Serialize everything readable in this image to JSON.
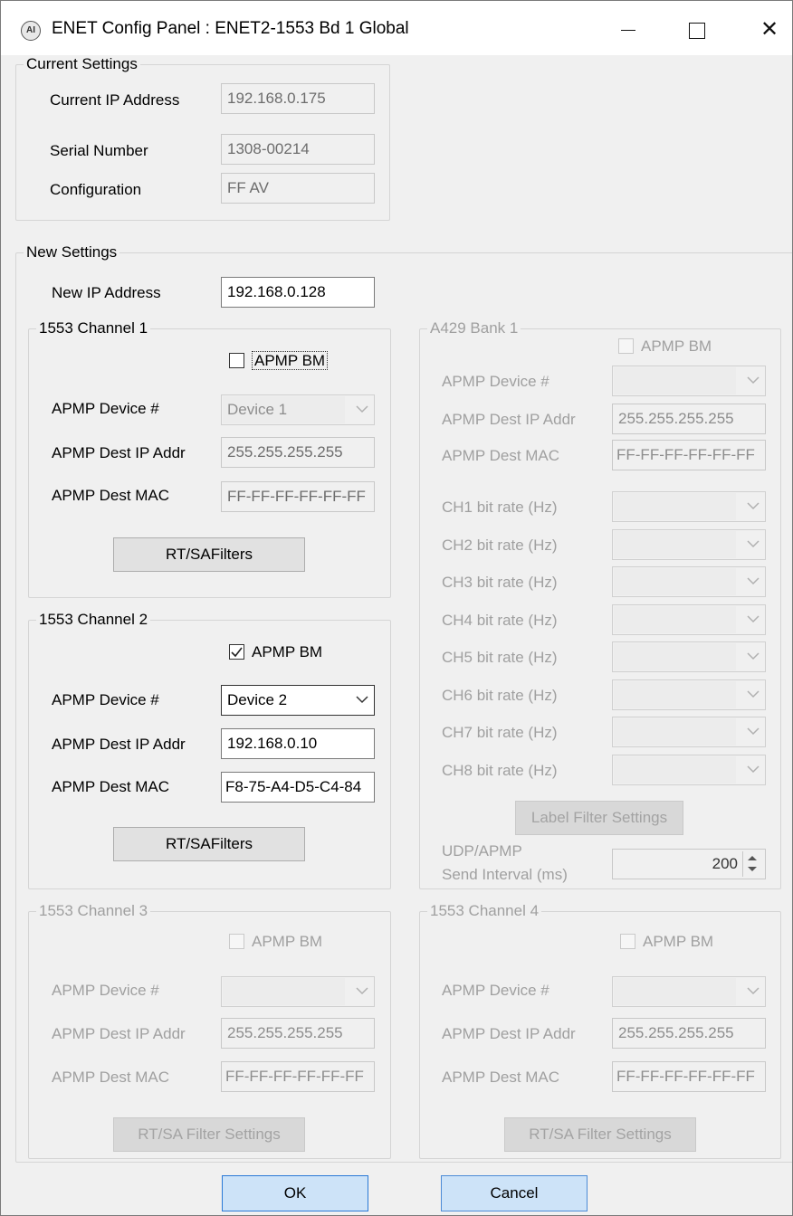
{
  "window": {
    "icon_text": "AI",
    "title": "ENET Config Panel : ENET2-1553 Bd 1 Global",
    "minimize_glyph": "",
    "close_glyph": "✕"
  },
  "current_settings": {
    "legend": "Current Settings",
    "ip_label": "Current IP Address",
    "ip_value": "192.168.0.175",
    "serial_label": "Serial Number",
    "serial_value": "1308-00214",
    "config_label": "Configuration",
    "config_value": "FF AV"
  },
  "new_settings": {
    "legend": "New Settings",
    "ip_label": "New IP Address",
    "ip_value": "192.168.0.128"
  },
  "labels": {
    "apmp_bm": "APMP BM",
    "device": "APMP Device #",
    "dest_ip": "APMP Dest IP Addr",
    "dest_mac": "APMP Dest MAC"
  },
  "channel1": {
    "legend": "1553 Channel 1",
    "apmp_bm_checked": false,
    "device": "Device 1",
    "dest_ip": "255.255.255.255",
    "dest_mac": "FF-FF-FF-FF-FF-FF",
    "filter_button": "RT/SAFilters"
  },
  "channel2": {
    "legend": "1553 Channel 2",
    "apmp_bm_checked": true,
    "device": "Device 2",
    "dest_ip": "192.168.0.10",
    "dest_mac": "F8-75-A4-D5-C4-84",
    "filter_button": "RT/SAFilters"
  },
  "channel3": {
    "legend": "1553 Channel 3",
    "apmp_bm_checked": false,
    "device": "",
    "dest_ip": "255.255.255.255",
    "dest_mac": "FF-FF-FF-FF-FF-FF",
    "filter_button": "RT/SA Filter Settings"
  },
  "channel4": {
    "legend": "1553 Channel 4",
    "apmp_bm_checked": false,
    "device": "",
    "dest_ip": "255.255.255.255",
    "dest_mac": "FF-FF-FF-FF-FF-FF",
    "filter_button": "RT/SA Filter Settings"
  },
  "a429": {
    "legend": "A429 Bank 1",
    "apmp_bm_checked": false,
    "device": "",
    "dest_ip": "255.255.255.255",
    "dest_mac": "FF-FF-FF-FF-FF-FF",
    "bitrates": [
      {
        "label": "CH1 bit rate (Hz)",
        "value": ""
      },
      {
        "label": "CH2 bit rate (Hz)",
        "value": ""
      },
      {
        "label": "CH3 bit rate (Hz)",
        "value": ""
      },
      {
        "label": "CH4 bit rate (Hz)",
        "value": ""
      },
      {
        "label": "CH5 bit rate (Hz)",
        "value": ""
      },
      {
        "label": "CH6 bit rate (Hz)",
        "value": ""
      },
      {
        "label": "CH7 bit rate (Hz)",
        "value": ""
      },
      {
        "label": "CH8 bit rate (Hz)",
        "value": ""
      }
    ],
    "label_filter_button": "Label Filter Settings",
    "udp_label_1": "UDP/APMP",
    "udp_label_2": "Send Interval (ms)",
    "udp_value": "200"
  },
  "footer": {
    "ok": "OK",
    "cancel": "Cancel"
  }
}
